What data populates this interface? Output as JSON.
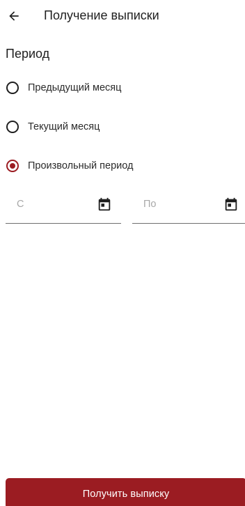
{
  "appbar": {
    "back_icon": "arrow-left-icon",
    "title": "Получение выписки"
  },
  "period": {
    "title": "Период",
    "options": [
      {
        "label": "Предыдущий месяц",
        "selected": false
      },
      {
        "label": "Текущий месяц",
        "selected": false
      },
      {
        "label": "Произвольный период",
        "selected": true
      }
    ]
  },
  "date_range": {
    "from": {
      "placeholder": "С",
      "value": "",
      "icon": "calendar-icon"
    },
    "to": {
      "placeholder": "По",
      "value": "",
      "icon": "calendar-icon"
    }
  },
  "submit": {
    "label": "Получить выписку"
  },
  "colors": {
    "accent": "#9b1c22",
    "text": "#1f1f1f",
    "placeholder": "#a8a8a8",
    "divider": "#6f6f6f"
  }
}
